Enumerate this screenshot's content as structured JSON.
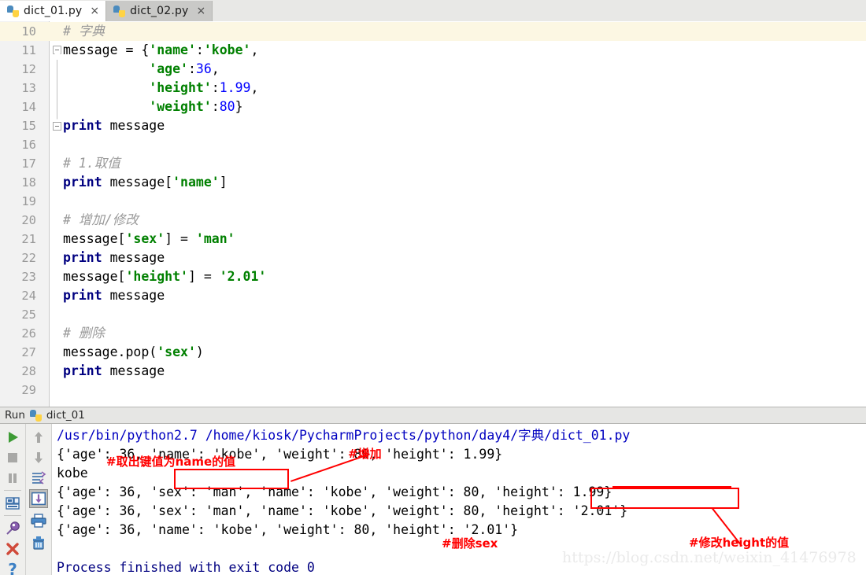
{
  "window": {
    "tabs": [
      {
        "label": "dict_01.py",
        "close": "×",
        "active": true,
        "icon": "python-file-icon"
      },
      {
        "label": "dict_02.py",
        "close": "×",
        "active": false,
        "icon": "python-file-icon"
      }
    ]
  },
  "editor": {
    "first_line_number": 10,
    "current_line": 10,
    "lines": [
      {
        "n": "10",
        "tokens": [
          {
            "t": "# 字典",
            "c": "cmt"
          }
        ]
      },
      {
        "n": "11",
        "tokens": [
          {
            "t": "message = {",
            "c": "pln"
          },
          {
            "t": "'name'",
            "c": "str"
          },
          {
            "t": ":",
            "c": "pln"
          },
          {
            "t": "'kobe'",
            "c": "str"
          },
          {
            "t": ",",
            "c": "pln"
          }
        ]
      },
      {
        "n": "12",
        "tokens": [
          {
            "t": "           ",
            "c": "pln"
          },
          {
            "t": "'age'",
            "c": "str"
          },
          {
            "t": ":",
            "c": "pln"
          },
          {
            "t": "36",
            "c": "num"
          },
          {
            "t": ",",
            "c": "pln"
          }
        ]
      },
      {
        "n": "13",
        "tokens": [
          {
            "t": "           ",
            "c": "pln"
          },
          {
            "t": "'height'",
            "c": "str"
          },
          {
            "t": ":",
            "c": "pln"
          },
          {
            "t": "1.99",
            "c": "num"
          },
          {
            "t": ",",
            "c": "pln"
          }
        ]
      },
      {
        "n": "14",
        "tokens": [
          {
            "t": "           ",
            "c": "pln"
          },
          {
            "t": "'weight'",
            "c": "str"
          },
          {
            "t": ":",
            "c": "pln"
          },
          {
            "t": "80",
            "c": "num"
          },
          {
            "t": "}",
            "c": "pln"
          }
        ]
      },
      {
        "n": "15",
        "tokens": [
          {
            "t": "print",
            "c": "kw"
          },
          {
            "t": " message",
            "c": "pln"
          }
        ]
      },
      {
        "n": "16",
        "tokens": []
      },
      {
        "n": "17",
        "tokens": [
          {
            "t": "# 1.取值",
            "c": "cmt"
          }
        ]
      },
      {
        "n": "18",
        "tokens": [
          {
            "t": "print",
            "c": "kw"
          },
          {
            "t": " message[",
            "c": "pln"
          },
          {
            "t": "'name'",
            "c": "str"
          },
          {
            "t": "]",
            "c": "pln"
          }
        ]
      },
      {
        "n": "19",
        "tokens": []
      },
      {
        "n": "20",
        "tokens": [
          {
            "t": "# 增加/修改",
            "c": "cmt"
          }
        ]
      },
      {
        "n": "21",
        "tokens": [
          {
            "t": "message[",
            "c": "pln"
          },
          {
            "t": "'sex'",
            "c": "str"
          },
          {
            "t": "] = ",
            "c": "pln"
          },
          {
            "t": "'man'",
            "c": "str"
          }
        ]
      },
      {
        "n": "22",
        "tokens": [
          {
            "t": "print",
            "c": "kw"
          },
          {
            "t": " message",
            "c": "pln"
          }
        ]
      },
      {
        "n": "23",
        "tokens": [
          {
            "t": "message[",
            "c": "pln"
          },
          {
            "t": "'height'",
            "c": "str"
          },
          {
            "t": "] = ",
            "c": "pln"
          },
          {
            "t": "'2.01'",
            "c": "str"
          }
        ]
      },
      {
        "n": "24",
        "tokens": [
          {
            "t": "print",
            "c": "kw"
          },
          {
            "t": " message",
            "c": "pln"
          }
        ]
      },
      {
        "n": "25",
        "tokens": []
      },
      {
        "n": "26",
        "tokens": [
          {
            "t": "# 删除",
            "c": "cmt"
          }
        ]
      },
      {
        "n": "27",
        "tokens": [
          {
            "t": "message.pop(",
            "c": "pln"
          },
          {
            "t": "'sex'",
            "c": "str"
          },
          {
            "t": ")",
            "c": "pln"
          }
        ]
      },
      {
        "n": "28",
        "tokens": [
          {
            "t": "print",
            "c": "kw"
          },
          {
            "t": " message",
            "c": "pln"
          }
        ]
      },
      {
        "n": "29",
        "tokens": []
      }
    ]
  },
  "runbar": {
    "label": "Run",
    "config_name": "dict_01",
    "icon": "python-config-icon"
  },
  "console": {
    "left_toolbar": [
      {
        "name": "run-button",
        "icon": "play-icon"
      },
      {
        "name": "stop-button",
        "icon": "stop-icon"
      },
      {
        "name": "pause-button",
        "icon": "pause-icon"
      },
      {
        "name": "restore-layout-button",
        "icon": "layout-icon"
      },
      {
        "name": "pin-tab-button",
        "icon": "pin-icon"
      },
      {
        "name": "close-button",
        "icon": "close-icon"
      },
      {
        "name": "help-button",
        "icon": "help-icon"
      }
    ],
    "right_toolbar": [
      {
        "name": "prev-occurrence-button",
        "icon": "arrow-up-icon"
      },
      {
        "name": "next-occurrence-button",
        "icon": "arrow-down-icon"
      },
      {
        "name": "soft-wrap-button",
        "icon": "soft-wrap-icon"
      },
      {
        "name": "scroll-to-end-button",
        "icon": "scroll-to-end-icon",
        "selected": true
      },
      {
        "name": "print-button",
        "icon": "printer-icon"
      },
      {
        "name": "clear-all-button",
        "icon": "trash-icon"
      }
    ],
    "output_lines": [
      {
        "text": "/usr/bin/python2.7 /home/kiosk/PycharmProjects/python/day4/字典/dict_01.py",
        "style": "link"
      },
      {
        "text": "{'age': 36, 'name': 'kobe', 'weight': 80, 'height': 1.99}",
        "style": "plain"
      },
      {
        "text": "kobe",
        "style": "plain"
      },
      {
        "text": "{'age': 36, 'sex': 'man', 'name': 'kobe', 'weight': 80, 'height': 1.99}",
        "style": "plain"
      },
      {
        "text": "{'age': 36, 'sex': 'man', 'name': 'kobe', 'weight': 80, 'height': '2.01'}",
        "style": "plain"
      },
      {
        "text": "{'age': 36, 'name': 'kobe', 'weight': 80, 'height': '2.01'}",
        "style": "plain"
      },
      {
        "text": "",
        "style": "plain"
      },
      {
        "text": "Process finished with exit code 0",
        "style": "finish"
      }
    ]
  },
  "annotations": {
    "color": "#ff0000",
    "labels": [
      {
        "text": "#取出键值为name的值",
        "name": "annotation-get-value"
      },
      {
        "text": "#增加",
        "name": "annotation-add"
      },
      {
        "text": "#删除sex",
        "name": "annotation-delete-sex"
      },
      {
        "text": "#修改height的值",
        "name": "annotation-modify-height"
      }
    ]
  },
  "watermark": {
    "text": "https://blog.csdn.net/weixin_41476978"
  }
}
